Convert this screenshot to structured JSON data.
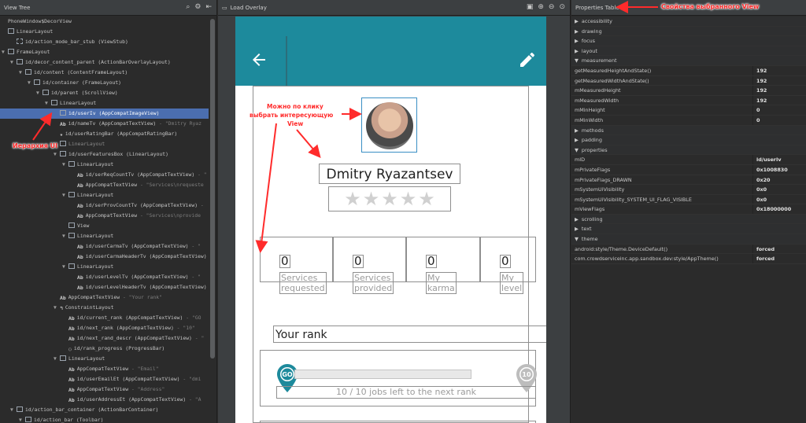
{
  "left": {
    "title": "View Tree",
    "tree": [
      {
        "depth": 0,
        "toggle": "",
        "icon": "",
        "name": "PhoneWindow$DecorView",
        "sub": ""
      },
      {
        "depth": 0,
        "toggle": "",
        "icon": "box",
        "name": "LinearLayout",
        "sub": ""
      },
      {
        "depth": 1,
        "toggle": "",
        "icon": "stub",
        "name": "id/action_mode_bar_stub (ViewStub)",
        "sub": ""
      },
      {
        "depth": 0,
        "toggle": "▼",
        "icon": "box",
        "name": "FrameLayout",
        "sub": ""
      },
      {
        "depth": 1,
        "toggle": "▼",
        "icon": "box",
        "name": "id/decor_content_parent (ActionBarOverlayLayout)",
        "sub": ""
      },
      {
        "depth": 2,
        "toggle": "▼",
        "icon": "box",
        "name": "id/content (ContentFrameLayout)",
        "sub": ""
      },
      {
        "depth": 3,
        "toggle": "▼",
        "icon": "box",
        "name": "id/container (FrameLayout)",
        "sub": ""
      },
      {
        "depth": 4,
        "toggle": "▼",
        "icon": "box",
        "name": "id/parent (ScrollView)",
        "sub": ""
      },
      {
        "depth": 5,
        "toggle": "▼",
        "icon": "box",
        "name": "LinearLayout",
        "sub": ""
      },
      {
        "depth": 6,
        "toggle": "",
        "icon": "box",
        "name": "id/userIv (AppCompatImageView)",
        "sub": "",
        "sel": true
      },
      {
        "depth": 6,
        "toggle": "",
        "icon": "Ab",
        "name": "id/nameTv (AppCompatTextView)",
        "sub": " - \"Dmitry Ryaz"
      },
      {
        "depth": 6,
        "toggle": "",
        "icon": "★",
        "name": "id/userRatingBar (AppCompatRatingBar)",
        "sub": ""
      },
      {
        "depth": 6,
        "toggle": "▶",
        "icon": "box",
        "name": "LinearLayout",
        "sub": "",
        "dim": true
      },
      {
        "depth": 6,
        "toggle": "▼",
        "icon": "box",
        "name": "id/userFeaturesBox (LinearLayout)",
        "sub": ""
      },
      {
        "depth": 7,
        "toggle": "▼",
        "icon": "box",
        "name": "LinearLayout",
        "sub": ""
      },
      {
        "depth": 8,
        "toggle": "",
        "icon": "Ab",
        "name": "id/serReqCountTv (AppCompatTextView)",
        "sub": " - \""
      },
      {
        "depth": 8,
        "toggle": "",
        "icon": "Ab",
        "name": "AppCompatTextView",
        "sub": " - \"Services\\nrequeste"
      },
      {
        "depth": 7,
        "toggle": "▼",
        "icon": "box",
        "name": "LinearLayout",
        "sub": ""
      },
      {
        "depth": 8,
        "toggle": "",
        "icon": "Ab",
        "name": "id/serProvCountTv (AppCompatTextView)",
        "sub": " - "
      },
      {
        "depth": 8,
        "toggle": "",
        "icon": "Ab",
        "name": "AppCompatTextView",
        "sub": " - \"Services\\nprovide"
      },
      {
        "depth": 7,
        "toggle": "",
        "icon": "box",
        "name": "View",
        "sub": ""
      },
      {
        "depth": 7,
        "toggle": "▼",
        "icon": "box",
        "name": "LinearLayout",
        "sub": ""
      },
      {
        "depth": 8,
        "toggle": "",
        "icon": "Ab",
        "name": "id/userCarmaTv (AppCompatTextView)",
        "sub": " - \""
      },
      {
        "depth": 8,
        "toggle": "",
        "icon": "Ab",
        "name": "id/userCarmaHeaderTv (AppCompatTextView)",
        "sub": ""
      },
      {
        "depth": 7,
        "toggle": "▼",
        "icon": "box",
        "name": "LinearLayout",
        "sub": ""
      },
      {
        "depth": 8,
        "toggle": "",
        "icon": "Ab",
        "name": "id/userLevelTv (AppCompatTextView)",
        "sub": " - \""
      },
      {
        "depth": 8,
        "toggle": "",
        "icon": "Ab",
        "name": "id/userLevelHeaderTv (AppCompatTextView)",
        "sub": ""
      },
      {
        "depth": 6,
        "toggle": "",
        "icon": "Ab",
        "name": "AppCompatTextView",
        "sub": " - \"Your rank\""
      },
      {
        "depth": 6,
        "toggle": "▼",
        "icon": "↰",
        "name": "ConstraintLayout",
        "sub": ""
      },
      {
        "depth": 7,
        "toggle": "",
        "icon": "Ab",
        "name": "id/current_rank (AppCompatTextView)",
        "sub": " - \"GO"
      },
      {
        "depth": 7,
        "toggle": "",
        "icon": "Ab",
        "name": "id/next_rank (AppCompatTextView)",
        "sub": " - \"10\""
      },
      {
        "depth": 7,
        "toggle": "",
        "icon": "Ab",
        "name": "id/next_rand_descr (AppCompatTextView)",
        "sub": " - \""
      },
      {
        "depth": 7,
        "toggle": "",
        "icon": "◌",
        "name": "id/rank_progress (ProgressBar)",
        "sub": ""
      },
      {
        "depth": 6,
        "toggle": "▼",
        "icon": "box",
        "name": "LinearLayout",
        "sub": ""
      },
      {
        "depth": 7,
        "toggle": "",
        "icon": "Ab",
        "name": "AppCompatTextView",
        "sub": " - \"Email\""
      },
      {
        "depth": 7,
        "toggle": "",
        "icon": "Ab",
        "name": "id/userEmailEt (AppCompatTextView)",
        "sub": " - \"dmi"
      },
      {
        "depth": 7,
        "toggle": "",
        "icon": "Ab",
        "name": "AppCompatTextView",
        "sub": " - \"Address\""
      },
      {
        "depth": 7,
        "toggle": "",
        "icon": "Ab",
        "name": "id/userAddressEt (AppCompatTextView)",
        "sub": " - \"A"
      },
      {
        "depth": 1,
        "toggle": "▼",
        "icon": "box",
        "name": "id/action_bar_container (ActionBarContainer)",
        "sub": ""
      },
      {
        "depth": 2,
        "toggle": "▼",
        "icon": "box",
        "name": "id/action_bar (Toolbar)",
        "sub": ""
      }
    ]
  },
  "center": {
    "title": "Load Overlay",
    "profile": {
      "name": "Dmitry Ryazantsev",
      "counters": [
        {
          "value": "0",
          "label1": "Services",
          "label2": "requested"
        },
        {
          "value": "0",
          "label1": "Services",
          "label2": "provided"
        },
        {
          "value": "0",
          "label1": "My",
          "label2": "karma"
        },
        {
          "value": "0",
          "label1": "My",
          "label2": "level"
        }
      ],
      "rank_title": "Your rank",
      "current_rank": "GO",
      "next_rank": "10",
      "rank_descr": "10 / 10 jobs left to the next rank"
    }
  },
  "right": {
    "title": "Properties Table",
    "rows": [
      {
        "cat": true,
        "open": false,
        "name": "accessibility",
        "value": ""
      },
      {
        "cat": true,
        "open": false,
        "name": "drawing",
        "value": ""
      },
      {
        "cat": true,
        "open": false,
        "name": "focus",
        "value": ""
      },
      {
        "cat": true,
        "open": false,
        "name": "layout",
        "value": ""
      },
      {
        "cat": true,
        "open": true,
        "name": "measurement",
        "value": ""
      },
      {
        "cat": false,
        "name": "getMeasuredHeightAndState()",
        "value": "192"
      },
      {
        "cat": false,
        "name": "getMeasuredWidthAndState()",
        "value": "192"
      },
      {
        "cat": false,
        "name": "mMeasuredHeight",
        "value": "192"
      },
      {
        "cat": false,
        "name": "mMeasuredWidth",
        "value": "192"
      },
      {
        "cat": false,
        "name": "mMinHeight",
        "value": "0"
      },
      {
        "cat": false,
        "name": "mMinWidth",
        "value": "0"
      },
      {
        "cat": true,
        "open": false,
        "name": "methods",
        "value": ""
      },
      {
        "cat": true,
        "open": false,
        "name": "padding",
        "value": ""
      },
      {
        "cat": true,
        "open": true,
        "name": "properties",
        "value": ""
      },
      {
        "cat": false,
        "name": "mID",
        "value": "id/userIv"
      },
      {
        "cat": false,
        "name": "mPrivateFlags",
        "value": "0x1008830"
      },
      {
        "cat": false,
        "name": "mPrivateFlags_DRAWN",
        "value": "0x20"
      },
      {
        "cat": false,
        "name": "mSystemUiVisibility",
        "value": "0x0"
      },
      {
        "cat": false,
        "name": "mSystemUiVisibility_SYSTEM_UI_FLAG_VISIBLE",
        "value": "0x0"
      },
      {
        "cat": false,
        "name": "mViewFlags",
        "value": "0x18000000"
      },
      {
        "cat": true,
        "open": false,
        "name": "scrolling",
        "value": ""
      },
      {
        "cat": true,
        "open": false,
        "name": "text",
        "value": ""
      },
      {
        "cat": true,
        "open": true,
        "name": "theme",
        "value": ""
      },
      {
        "cat": false,
        "name": "android:style/Theme.DeviceDefault()",
        "value": "forced"
      },
      {
        "cat": false,
        "name": "com.crowdserviceinc.app.sandbox.dev:style/AppTheme()",
        "value": "forced"
      }
    ]
  },
  "annotations": {
    "hierarchy": "Иерархия UI",
    "click_hint_1": "Можно по клику",
    "click_hint_2": "выбрать интересующую",
    "click_hint_3": "View",
    "props_hint": "Свойства выбранного View"
  },
  "colors": {
    "accent": "#1d8a9c",
    "selection": "#4b6eaf",
    "annotation": "#ff2b2b"
  }
}
